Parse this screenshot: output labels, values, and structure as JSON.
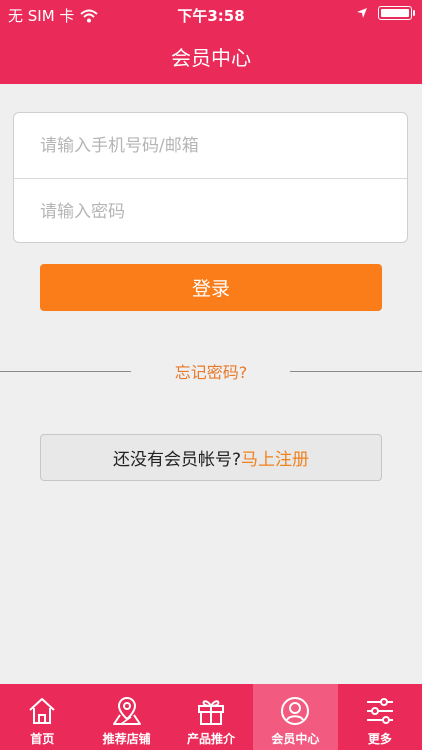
{
  "status_bar": {
    "carrier": "无 SIM 卡",
    "time": "下午3:58"
  },
  "header": {
    "title": "会员中心"
  },
  "form": {
    "phone_placeholder": "请输入手机号码/邮箱",
    "password_placeholder": "请输入密码",
    "login_label": "登录",
    "forgot_label": "忘记密码?"
  },
  "register": {
    "prompt": "还没有会员帐号?",
    "link": "马上注册"
  },
  "tabs": [
    {
      "label": "首页",
      "icon": "home-icon"
    },
    {
      "label": "推荐店铺",
      "icon": "map-location-icon"
    },
    {
      "label": "产品推介",
      "icon": "gift-icon"
    },
    {
      "label": "会员中心",
      "icon": "user-icon",
      "active": true
    },
    {
      "label": "更多",
      "icon": "sliders-icon"
    }
  ],
  "colors": {
    "brand": "#ea2a58",
    "accent": "#fa7d1a",
    "active_tab": "#f25a80"
  }
}
